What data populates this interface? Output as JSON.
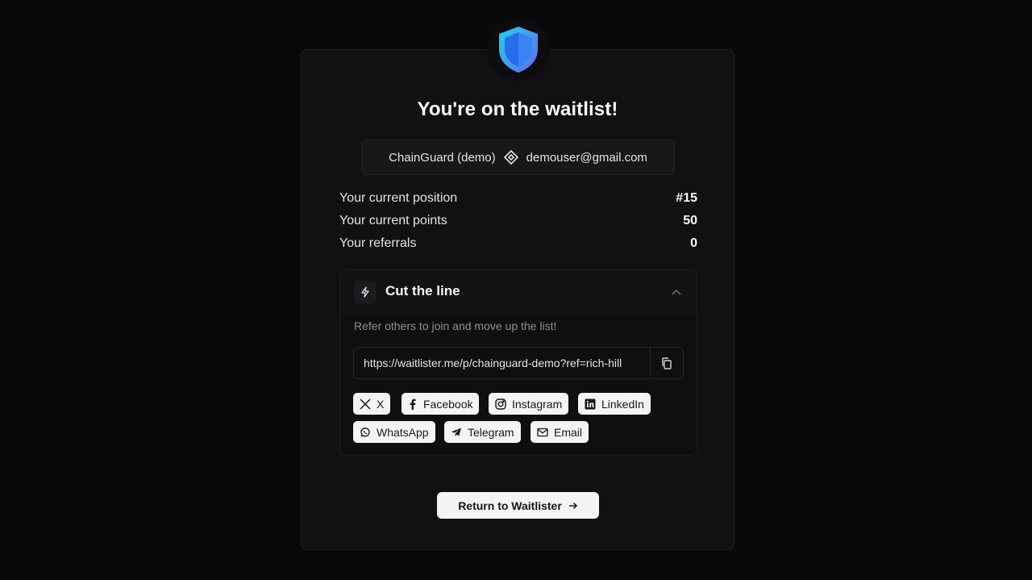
{
  "header": {
    "logo_icon": "shield-logo-icon",
    "title": "You're on the waitlist!"
  },
  "identity": {
    "project": "ChainGuard (demo)",
    "separator_icon": "tag-icon",
    "email": "demouser@gmail.com"
  },
  "stats": [
    {
      "label": "Your current position",
      "value": "#15"
    },
    {
      "label": "Your current points",
      "value": "50"
    },
    {
      "label": "Your referrals",
      "value": "0"
    }
  ],
  "cut_the_line": {
    "icon": "bolt-icon",
    "title": "Cut the line",
    "expanded": true,
    "description": "Refer others to join and move up the list!",
    "referral_url": "https://waitlister.me/p/chainguard-demo?ref=rich-hill",
    "copy_icon": "copy-icon",
    "share_buttons": [
      {
        "label": "X",
        "icon": "x-icon"
      },
      {
        "label": "Facebook",
        "icon": "facebook-icon"
      },
      {
        "label": "Instagram",
        "icon": "instagram-icon"
      },
      {
        "label": "LinkedIn",
        "icon": "linkedin-icon"
      },
      {
        "label": "WhatsApp",
        "icon": "whatsapp-icon"
      },
      {
        "label": "Telegram",
        "icon": "telegram-icon"
      },
      {
        "label": "Email",
        "icon": "mail-icon"
      }
    ]
  },
  "footer": {
    "return_label": "Return to Waitlister",
    "return_icon": "arrow-right-icon"
  },
  "colors": {
    "background": "#09090b",
    "card": "#111113",
    "shield_primary": "#3b82f6",
    "shield_accent": "#22d3ee",
    "button_bg": "#f4f4f5"
  }
}
